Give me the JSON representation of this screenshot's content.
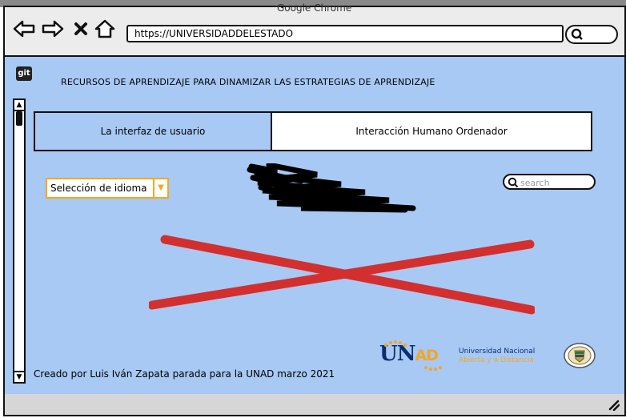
{
  "window": {
    "title": "Google Chrome",
    "url": "https://UNIVERSIDADDELESTADO"
  },
  "icons": {
    "back": "arrow-left-icon",
    "forward": "arrow-right-icon",
    "close": "close-icon",
    "home": "home-icon",
    "search": "search-icon",
    "logo": "git-logo"
  },
  "logo": {
    "text": "git"
  },
  "page": {
    "title": "RECURSOS DE APRENDIZAJE PARA DINAMIZAR LAS ESTRATEGIAS DE APRENDIZAJE",
    "tabs": [
      {
        "label": "La interfaz de usuario",
        "active": true
      },
      {
        "label": "Interacción Humano Ordenador",
        "active": false
      }
    ],
    "language_select": {
      "value": "Selección de idioma"
    },
    "search": {
      "placeholder": "search"
    },
    "footer": "Creado por Luis Iván Zapata parada para la UNAD marzo 2021"
  },
  "brand": {
    "unad_u": "U",
    "unad_n": "N",
    "unad_ad": "AD",
    "line1": "Universidad Nacional",
    "line2": "Abierta y a Distancia",
    "colors": {
      "navy": "#0a2e6e",
      "orange": "#f5a623",
      "canvas": "#a7c9f4",
      "x_mark": "#d32f2f"
    }
  }
}
